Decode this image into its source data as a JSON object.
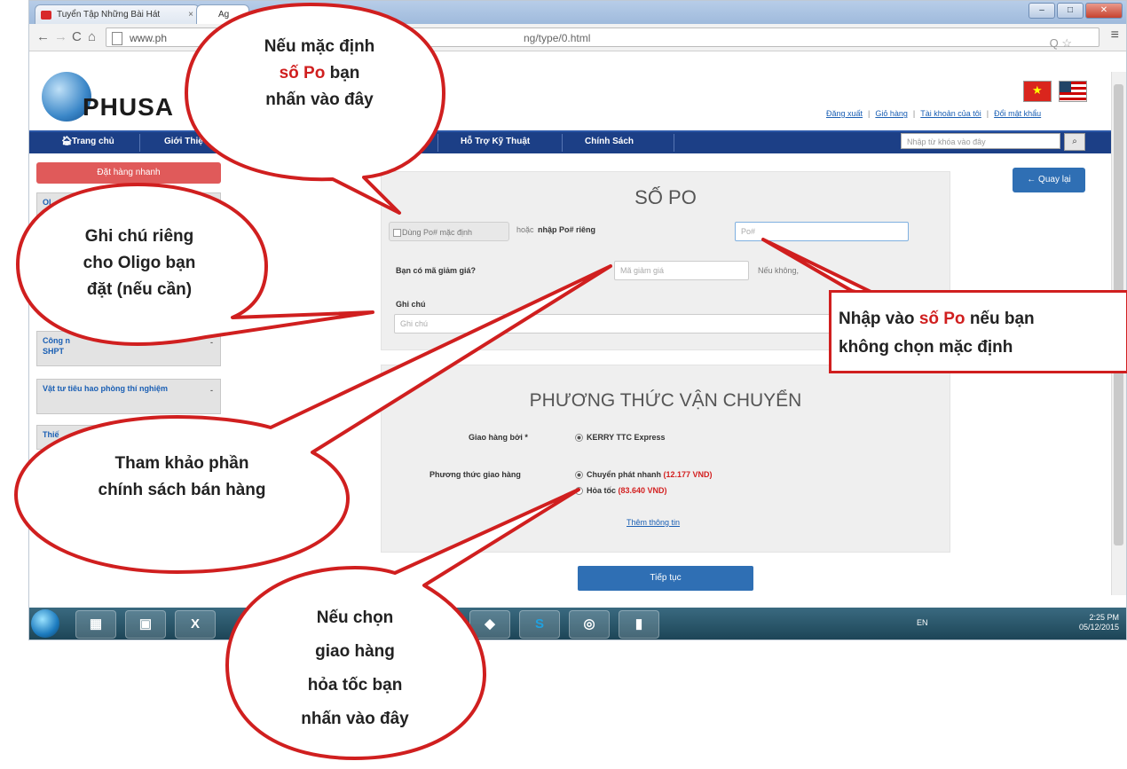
{
  "browser": {
    "tab1_title": "Tuyển Tập Những Bài Hát",
    "tab2_title": "Ag",
    "url_prefix": "www.ph",
    "url_suffix": "ng/type/0.html"
  },
  "site": {
    "logo_text": "PHUSA",
    "top_links": [
      "Đăng xuất",
      "Giỏ hàng",
      "Tài khoản của tôi",
      "Đổi mật khẩu"
    ],
    "nav": [
      "Trang chủ",
      "Giới Thiệ",
      "ng",
      "Hỗ Trợ Kỹ Thuật",
      "Chính Sách"
    ],
    "search_placeholder": "Nhập từ khóa vào đây",
    "search_icon": "search-icon"
  },
  "sidebar": {
    "quick_order": "Đặt hàng nhanh",
    "items": [
      {
        "label": "Ol"
      },
      {
        "label": "Công n"
      },
      {
        "label": "SHPT"
      },
      {
        "label": "Vật tư tiêu hao phòng thí nghiệm"
      },
      {
        "label": "Thiế"
      }
    ]
  },
  "po_panel": {
    "title": "SỐ PO",
    "default_po_button": "Dùng Po# mặc định",
    "or_text": "hoặc",
    "custom_po_label": "nhập Po# riêng",
    "po_placeholder": "Po#",
    "discount_label": "Bạn có mã giảm giá?",
    "discount_placeholder": "Mã giảm giá",
    "discount_note": "Nếu không,",
    "note_label": "Ghi chú",
    "note_placeholder": "Ghi chú"
  },
  "shipping_panel": {
    "title": "PHƯƠNG THỨC VẬN CHUYỂN",
    "carrier_label": "Giao hàng bởi *",
    "carrier_value": "KERRY TTC Express",
    "method_label": "Phương thức giao hàng",
    "option1_label": "Chuyển phát nhanh",
    "option1_price": "(12.177 VND)",
    "option2_label": "Hỏa tốc",
    "option2_price": "(83.640 VND)",
    "more_info": "Thêm thông tin"
  },
  "buttons": {
    "back": "Quay lại",
    "continue": "Tiếp tục"
  },
  "taskbar": {
    "lang": "EN",
    "time": "2:25 PM",
    "date": "05/12/2015"
  },
  "callouts": {
    "top": {
      "line1": "Nếu mặc định",
      "line2_hl": "số Po",
      "line2_rest": " bạn",
      "line3": "nhấn vào đây"
    },
    "left": {
      "line1": "Ghi chú riêng",
      "line2": "cho Oligo bạn",
      "line3": "đặt (nếu cần)"
    },
    "policy": {
      "line1": "Tham khảo phần",
      "line2": "chính sách bán hàng"
    },
    "express": {
      "line1": "Nếu chọn",
      "line2": "giao hàng",
      "line3": "hỏa tốc bạn",
      "line4": "nhấn vào đây"
    },
    "box": {
      "part1": "Nhập vào ",
      "hl": "số Po",
      "part2": " nếu bạn",
      "line2": "không chọn mặc định"
    }
  },
  "colors": {
    "nav_bg": "#1c3f86",
    "accent_red": "#d01f1f",
    "button_blue": "#2f6fb4"
  }
}
